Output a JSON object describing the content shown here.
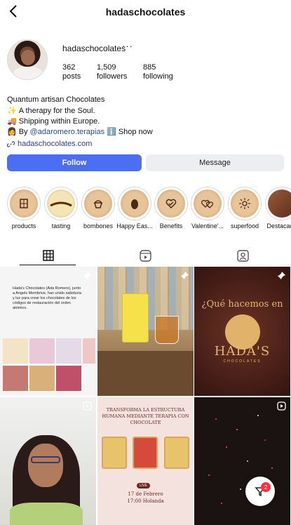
{
  "header": {
    "title": "hadaschocolates",
    "back_icon": "chevron-left-icon"
  },
  "profile": {
    "username": "hadaschocolates",
    "more_icon": "more-dots-icon",
    "stats": [
      {
        "value": "362",
        "label": "posts"
      },
      {
        "value": "1,509",
        "label": "followers"
      },
      {
        "value": "885",
        "label": "following"
      }
    ]
  },
  "bio": {
    "name": "Quantum artisan Chocolates",
    "line1_emoji": "✨",
    "line1": "A therapy for the Soul.",
    "line2_emoji": "🚚",
    "line2": "Shipping within Europe.",
    "line3_emoji": "👩",
    "line3_prefix": "By",
    "line3_mention": "@adaromero.terapias",
    "line3_emoji2": "ℹ️",
    "line3_suffix": "Shop now",
    "link": "hadaschocolates.com"
  },
  "actions": {
    "follow": "Follow",
    "message": "Message"
  },
  "highlights": [
    {
      "label": "products",
      "icon": "chocolate-bar-icon"
    },
    {
      "label": "tasting",
      "icon": "chocolate-logo-icon"
    },
    {
      "label": "bombones",
      "icon": "cupcake-icon"
    },
    {
      "label": "Happy Eas...",
      "icon": "easter-egg-icon"
    },
    {
      "label": "Benefits",
      "icon": "heart-check-icon"
    },
    {
      "label": "Valentine'...",
      "icon": "two-hearts-icon"
    },
    {
      "label": "superfood",
      "icon": "sun-icon"
    },
    {
      "label": "Destacado",
      "icon": "photo-icon"
    }
  ],
  "tabs": [
    {
      "name": "posts-grid",
      "icon": "grid-icon"
    },
    {
      "name": "reels",
      "icon": "reels-icon"
    },
    {
      "name": "tagged",
      "icon": "tagged-person-icon"
    }
  ],
  "posts": {
    "post1_text": "Hada's Chocolates (Ada Romero), junto a Angels Membrive, han unido sabiduría y luz para crear los chocolates de los códigos de restauración del orden atómico.",
    "post3_heading": "¿Qué hacemos en",
    "post3_brand": "HADA'S",
    "post3_sub": "CHOCOLATES",
    "post5_heading": "TRANSFORMA LA ESTRUCTURA HUMANA MEDIANTE TERAPIA CON CHOCOLATE",
    "post5_live": "LIVE",
    "post5_date_line1": "17 de Febrero",
    "post5_date_line2": "17:00 Holanda"
  },
  "fab": {
    "icon": "heart-filter-icon",
    "badge": "2"
  },
  "colors": {
    "follow": "#4c6ef5",
    "badge": "#ff3040",
    "link": "#2b3d8a"
  }
}
